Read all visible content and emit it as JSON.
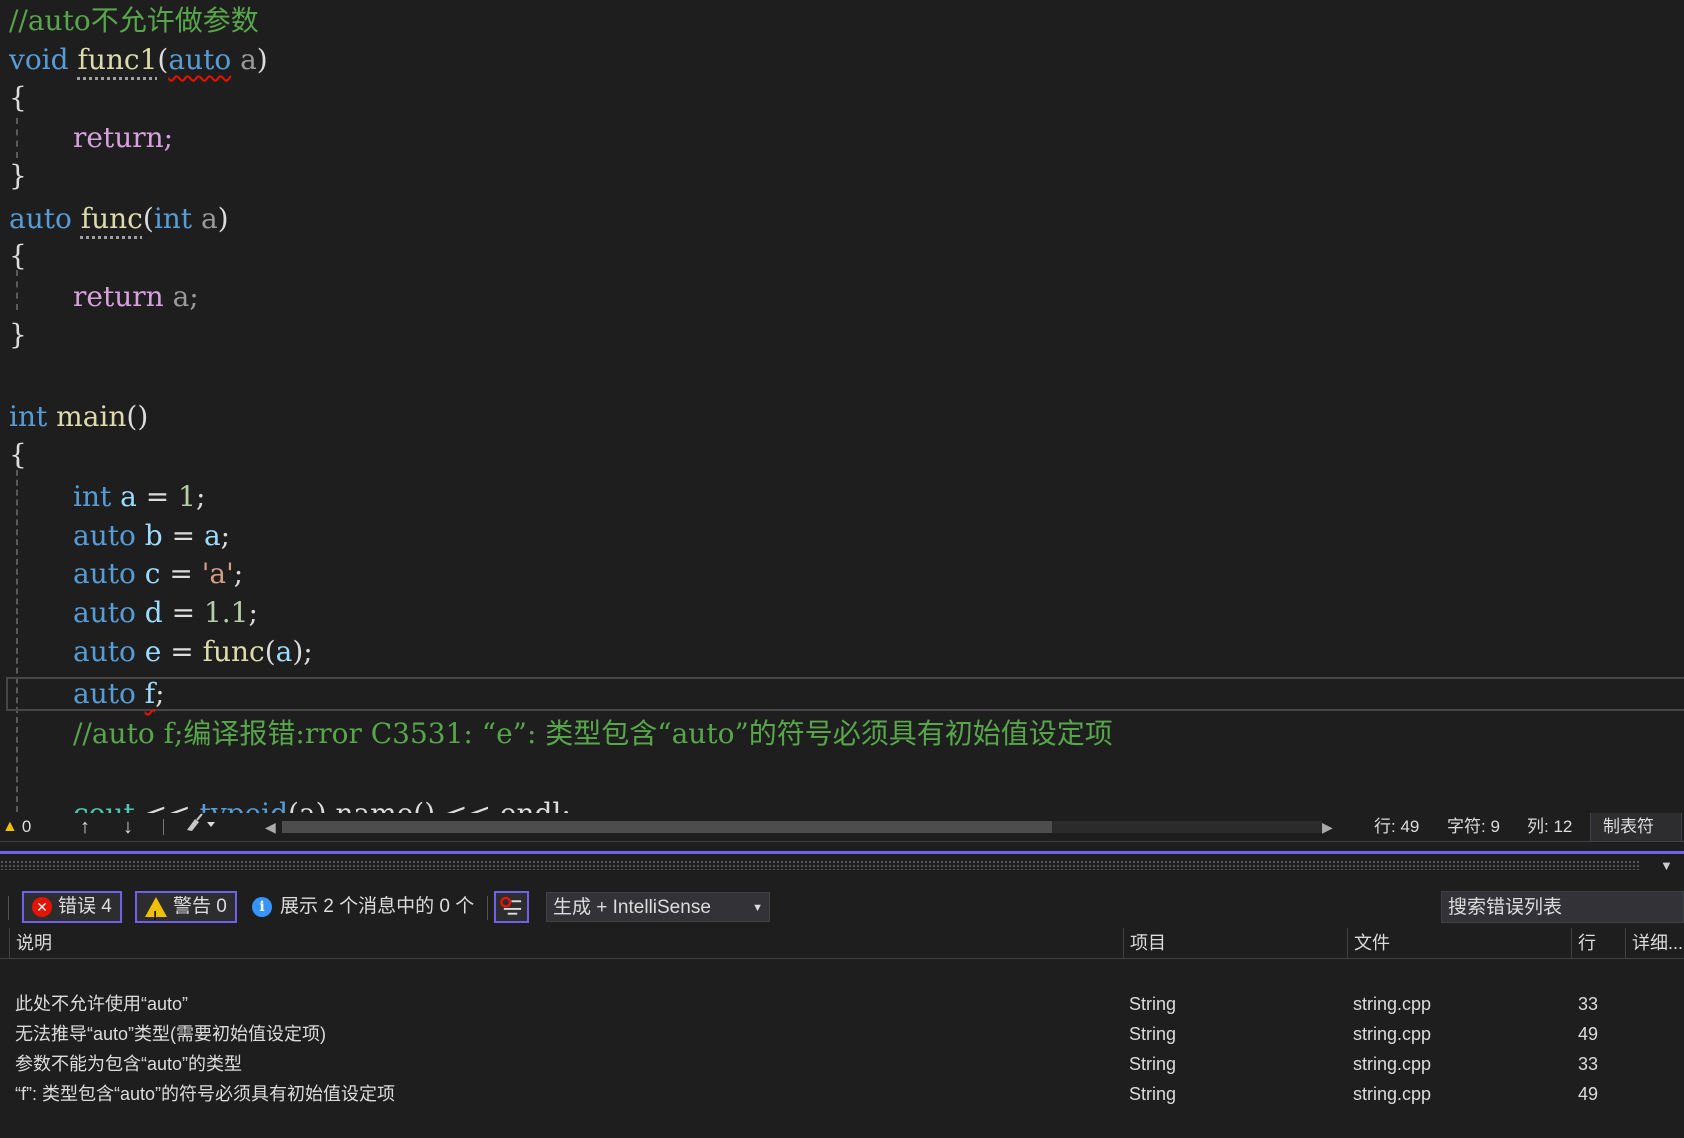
{
  "editor": {
    "lines": {
      "l1": "//auto不允许做参数",
      "l2_kw": "void",
      "l2_fn": "func1",
      "l2_open": "(",
      "l2_auto": "auto",
      "l2_param": " a",
      "l2_close": ")",
      "l3": "{",
      "l4": "return;",
      "l5": "}",
      "l6_kw": "auto",
      "l6_fn": "func",
      "l6_open": "(",
      "l6_int": "int",
      "l6_param": " a",
      "l6_close": ")",
      "l7": "{",
      "l8_kw": "return",
      "l8_rest": " a;",
      "l9": "}",
      "l10_kw": "int",
      "l10_fn": "main",
      "l10_rest": "()",
      "l11": "{",
      "l12_kw": "int",
      "l12_var": " a",
      "l12_eq": " = ",
      "l12_num": "1",
      "l12_end": ";",
      "l13_kw": "auto",
      "l13_var": " b",
      "l13_eq": " = ",
      "l13_val": "a",
      "l13_end": ";",
      "l14_kw": "auto",
      "l14_var": " c",
      "l14_eq": " = ",
      "l14_str": "'a'",
      "l14_end": ";",
      "l15_kw": "auto",
      "l15_var": " d",
      "l15_eq": " = ",
      "l15_num": "1.1",
      "l15_end": ";",
      "l16_kw": "auto",
      "l16_var": " e",
      "l16_eq": " = ",
      "l16_fn": "func",
      "l16_open": "(",
      "l16_arg": "a",
      "l16_close": ");",
      "l17_kw": "auto",
      "l17_sp": " ",
      "l17_var": "f",
      "l17_end": ";",
      "l18": "//auto f;编译报错:rror C3531: “e”: 类型包含“auto”的符号必须具有初始值设定项",
      "l19_a": "cout",
      "l19_b": " << ",
      "l19_c": "typeid",
      "l19_d": "(a).name() << endl;"
    }
  },
  "editor_status": {
    "warning_count": "0",
    "up_arrow": "↑",
    "down_arrow": "↓",
    "line_label": "行: 49",
    "char_label": "字符: 9",
    "col_label": "列: 12",
    "tab_mode": "制表符"
  },
  "error_list": {
    "errors_label": "错误 4",
    "warnings_label": "警告 0",
    "messages_label": "展示 2 个消息中的 0 个",
    "scope": "生成 + IntelliSense",
    "search_placeholder": "搜索错误列表",
    "columns": {
      "description": "说明",
      "project": "项目",
      "file": "文件",
      "line": "行",
      "details": "详细..."
    },
    "rows": [
      {
        "description": "此处不允许使用“auto”",
        "project": "String",
        "file": "string.cpp",
        "line": "33"
      },
      {
        "description": "无法推导“auto”类型(需要初始值设定项)",
        "project": "String",
        "file": "string.cpp",
        "line": "49"
      },
      {
        "description": "参数不能为包含“auto”的类型",
        "project": "String",
        "file": "string.cpp",
        "line": "33"
      },
      {
        "description": "“f”: 类型包含“auto”的符号必须具有初始值设定项",
        "project": "String",
        "file": "string.cpp",
        "line": "49"
      }
    ]
  },
  "colors": {
    "comment": "#57a64a",
    "keyword": "#569cd6",
    "control": "#d8a0df",
    "function": "#dcdcaa",
    "accent": "#7160e8",
    "error": "#e51400",
    "warning": "#f0c000",
    "info": "#3794ff"
  }
}
